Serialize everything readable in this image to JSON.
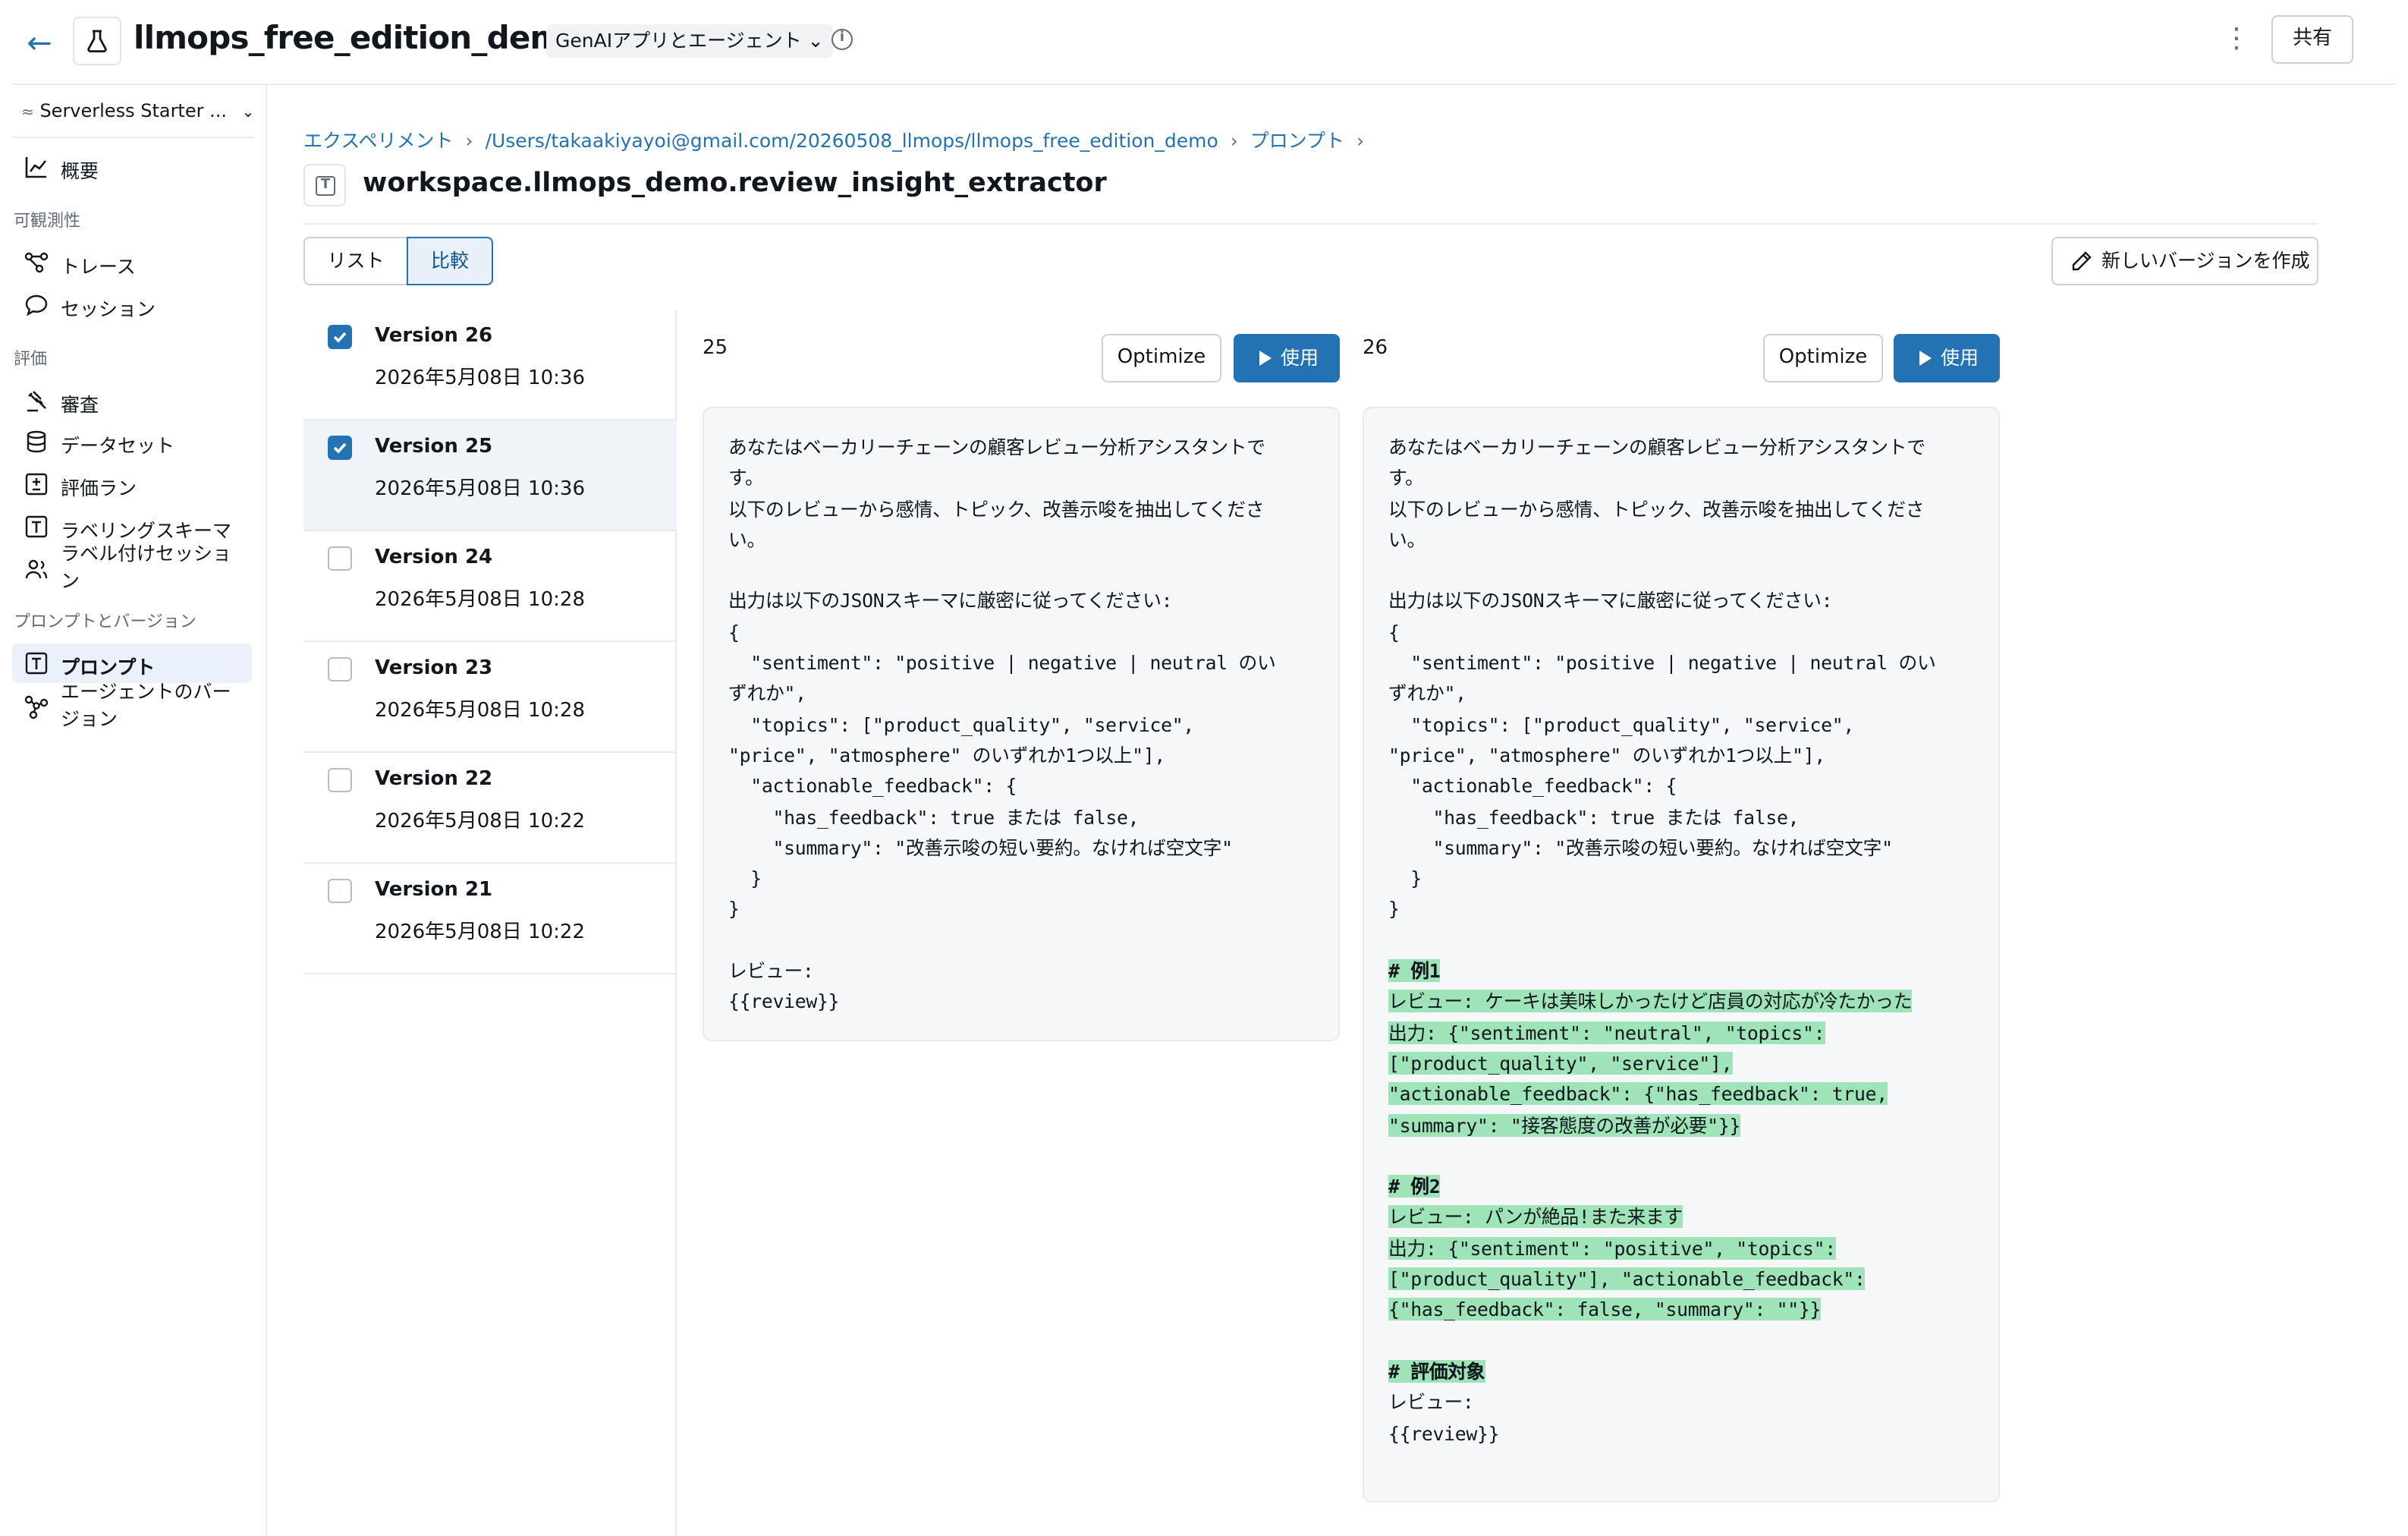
{
  "header": {
    "back_icon": "arrow-left-icon",
    "title": "llmops_free_edition_demo",
    "tag": "GenAIアプリとエージェント",
    "share_label": "共有"
  },
  "sidebar": {
    "workspace": "Serverless Starter ...",
    "items": [
      {
        "label": "概要",
        "icon": "chart-line-icon"
      },
      {
        "section": "可観測性"
      },
      {
        "label": "トレース",
        "icon": "trace-icon"
      },
      {
        "label": "セッション",
        "icon": "chat-bubble-icon"
      },
      {
        "section": "評価"
      },
      {
        "label": "審査",
        "icon": "gavel-icon"
      },
      {
        "label": "データセット",
        "icon": "database-icon"
      },
      {
        "label": "評価ラン",
        "icon": "plus-minus-icon"
      },
      {
        "label": "ラベリングスキーマ",
        "icon": "text-box-icon"
      },
      {
        "label": "ラベル付けセッション",
        "icon": "users-icon"
      },
      {
        "section": "プロンプトとバージョン"
      },
      {
        "label": "プロンプト",
        "icon": "text-box-icon",
        "active": true
      },
      {
        "label": "エージェントのバージョン",
        "icon": "nodes-icon"
      }
    ]
  },
  "breadcrumb": [
    "エクスペリメント",
    "/Users/takaakiyayoi@gmail.com/20260508_llmops/llmops_free_edition_demo",
    "プロンプト"
  ],
  "prompt_title": "workspace.llmops_demo.review_insight_extractor",
  "view_toggle": {
    "list": "リスト",
    "compare": "比較",
    "selected": "compare"
  },
  "new_version_label": "新しいバージョンを作成",
  "versions": [
    {
      "name": "Version 26",
      "date": "2026年5月08日 10:36",
      "checked": true
    },
    {
      "name": "Version 25",
      "date": "2026年5月08日 10:36",
      "checked": true
    },
    {
      "name": "Version 24",
      "date": "2026年5月08日 10:28",
      "checked": false
    },
    {
      "name": "Version 23",
      "date": "2026年5月08日 10:28",
      "checked": false
    },
    {
      "name": "Version 22",
      "date": "2026年5月08日 10:22",
      "checked": false
    },
    {
      "name": "Version 21",
      "date": "2026年5月08日 10:22",
      "checked": false
    }
  ],
  "compare": {
    "optimize_label": "Optimize",
    "use_label": "使用",
    "left": {
      "version": "25",
      "text": "あなたはベーカリーチェーンの顧客レビュー分析アシスタントで\nす。\n以下のレビューから感情、トピック、改善示唆を抽出してくださ\nい。\n\n出力は以下のJSONスキーマに厳密に従ってください:\n{\n  \"sentiment\": \"positive | negative | neutral のい\nずれか\",\n  \"topics\": [\"product_quality\", \"service\",\n\"price\", \"atmosphere\" のいずれか1つ以上\"],\n  \"actionable_feedback\": {\n    \"has_feedback\": true または false,\n    \"summary\": \"改善示唆の短い要約。なければ空文字\"\n  }\n}\n\nレビュー:\n{{review}}"
    },
    "right": {
      "version": "26",
      "text_common": "あなたはベーカリーチェーンの顧客レビュー分析アシスタントで\nす。\n以下のレビューから感情、トピック、改善示唆を抽出してくださ\nい。\n\n出力は以下のJSONスキーマに厳密に従ってください:\n{\n  \"sentiment\": \"positive | negative | neutral のい\nずれか\",\n  \"topics\": [\"product_quality\", \"service\",\n\"price\", \"atmosphere\" のいずれか1つ以上\"],\n  \"actionable_feedback\": {\n    \"has_feedback\": true または false,\n    \"summary\": \"改善示唆の短い要約。なければ空文字\"\n  }\n}\n\n",
      "added": [
        "# 例1",
        "レビュー: ケーキは美味しかったけど店員の対応が冷たかった",
        "出力: {\"sentiment\": \"neutral\", \"topics\":",
        "[\"product_quality\", \"service\"],",
        "\"actionable_feedback\": {\"has_feedback\": true,",
        "\"summary\": \"接客態度の改善が必要\"}}",
        "",
        "# 例2",
        "レビュー: パンが絶品!また来ます",
        "出力: {\"sentiment\": \"positive\", \"topics\":",
        "[\"product_quality\"], \"actionable_feedback\":",
        "{\"has_feedback\": false, \"summary\": \"\"}}",
        "",
        "# 評価対象"
      ],
      "text_tail": "レビュー:\n{{review}}"
    }
  }
}
